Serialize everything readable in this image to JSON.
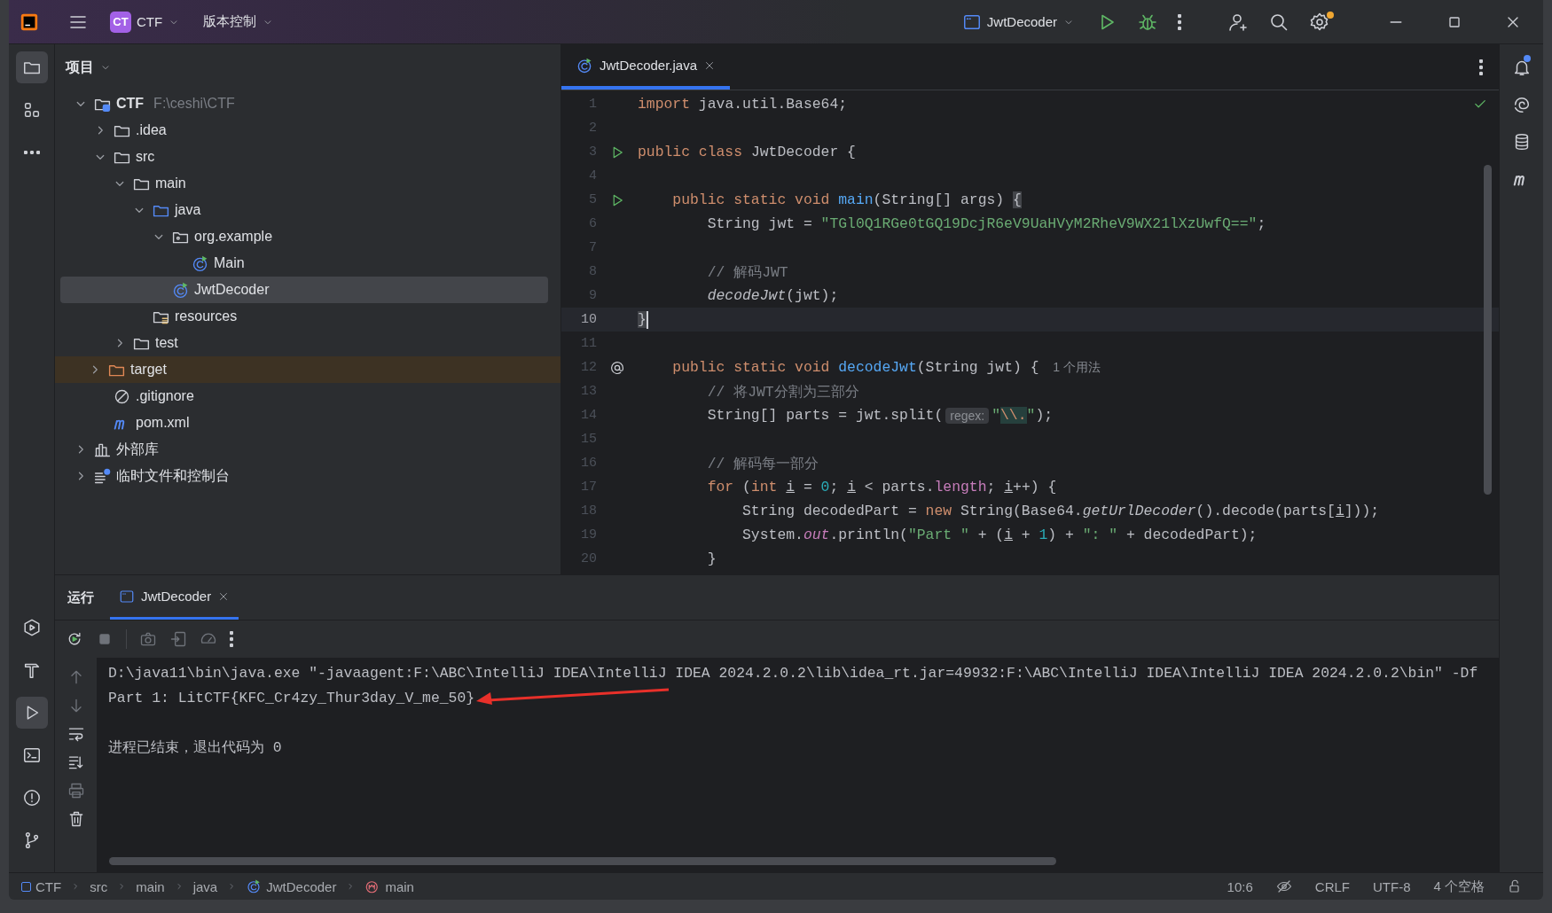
{
  "title_bar": {
    "project_badge": "CT",
    "project": "CTF",
    "vcs": "版本控制",
    "run_config": "JwtDecoder",
    "settings_badge": true
  },
  "tool_strip": {
    "top": [
      {
        "selected": true
      },
      {
        "selected": false
      },
      {
        "selected": false
      }
    ],
    "bottom": [
      {
        "selected": false
      },
      {
        "selected": false
      },
      {
        "selected": true
      },
      {
        "selected": false
      },
      {
        "selected": false
      },
      {
        "selected": false
      }
    ]
  },
  "project_panel": {
    "title": "项目",
    "tree": [
      {
        "label": "CTF",
        "hint": "F:\\ceshi\\CTF",
        "kind": "module",
        "expanded": true,
        "selected": false,
        "children": [
          {
            "label": ".idea",
            "kind": "folder",
            "expanded": false,
            "selected": false
          },
          {
            "label": "src",
            "kind": "folder",
            "expanded": true,
            "selected": false,
            "children": [
              {
                "label": "main",
                "kind": "folder",
                "expanded": true,
                "selected": false,
                "children": [
                  {
                    "label": "java",
                    "kind": "sources",
                    "expanded": true,
                    "selected": false,
                    "children": [
                      {
                        "label": "org.example",
                        "kind": "package",
                        "expanded": true,
                        "selected": false,
                        "children": [
                          {
                            "label": "Main",
                            "kind": "class",
                            "selected": false
                          }
                        ]
                      },
                      {
                        "label": "JwtDecoder",
                        "kind": "class",
                        "selected": true
                      }
                    ]
                  },
                  {
                    "label": "resources",
                    "kind": "resources",
                    "selected": false
                  }
                ]
              },
              {
                "label": "test",
                "kind": "folder",
                "expanded": false,
                "selected": false
              }
            ]
          },
          {
            "label": "target",
            "kind": "excluded",
            "expanded": false,
            "selected": false
          },
          {
            "label": ".gitignore",
            "kind": "ignore",
            "selected": false
          },
          {
            "label": "pom.xml",
            "kind": "maven",
            "selected": false
          }
        ]
      },
      {
        "label": "外部库",
        "kind": "library",
        "expanded": false,
        "selected": false
      },
      {
        "label": "临时文件和控制台",
        "kind": "scratch",
        "expanded": false,
        "selected": false
      }
    ]
  },
  "editor": {
    "tabs": [
      {
        "label": "JwtDecoder.java",
        "selected": true
      }
    ],
    "lines": [
      {
        "n": "1",
        "kind": "plain",
        "current": false,
        "tokens": [
          {
            "kind": "keyword",
            "text": "import"
          },
          {
            "kind": "plain",
            "text": " java.util.Base64;"
          }
        ]
      },
      {
        "n": "2",
        "kind": "plain",
        "current": false
      },
      {
        "n": "3",
        "kind": "run",
        "current": false,
        "tokens": [
          {
            "kind": "keyword",
            "text": "public class "
          },
          {
            "kind": "plain",
            "text": "JwtDecoder {"
          }
        ]
      },
      {
        "n": "4",
        "kind": "plain",
        "current": false
      },
      {
        "n": "5",
        "kind": "run",
        "current": false,
        "tokens": [
          {
            "kind": "keyword",
            "text": "    public static void "
          },
          {
            "kind": "declaration",
            "text": "main"
          },
          {
            "kind": "plain",
            "text": "(String[] args) "
          },
          {
            "kind": "brace",
            "text": "{"
          }
        ]
      },
      {
        "n": "6",
        "kind": "plain",
        "current": false,
        "tokens": [
          {
            "kind": "plain",
            "text": "        String jwt = "
          },
          {
            "kind": "string",
            "text": "\"TGl0Q1RGe0tGQ19DcjR6eV9UaHVyM2RheV9WX21lXzUwfQ==\""
          },
          {
            "kind": "plain",
            "text": ";"
          }
        ]
      },
      {
        "n": "7",
        "kind": "plain",
        "current": false
      },
      {
        "n": "8",
        "kind": "plain",
        "current": false,
        "tokens": [
          {
            "kind": "comment",
            "text": "        // 解码JWT"
          }
        ]
      },
      {
        "n": "9",
        "kind": "plain",
        "current": false,
        "tokens": [
          {
            "kind": "static",
            "text": "        decodeJwt"
          },
          {
            "kind": "plain",
            "text": "(jwt);"
          }
        ]
      },
      {
        "n": "10",
        "kind": "plain",
        "current": true,
        "tokens": [
          {
            "kind": "brace",
            "text": "    }"
          }
        ]
      },
      {
        "n": "11",
        "kind": "plain",
        "current": false
      },
      {
        "n": "12",
        "kind": "override",
        "current": false,
        "tokens": [
          {
            "kind": "keyword",
            "text": "    public static void "
          },
          {
            "kind": "declaration",
            "text": "decodeJwt"
          },
          {
            "kind": "plain",
            "text": "(String jwt) { "
          },
          {
            "kind": "usage",
            "text": "1 个用法"
          }
        ]
      },
      {
        "n": "13",
        "kind": "plain",
        "current": false,
        "tokens": [
          {
            "kind": "comment",
            "text": "        // 将JWT分割为三部分"
          }
        ]
      },
      {
        "n": "14",
        "kind": "plain",
        "current": false,
        "tokens": [
          {
            "kind": "plain",
            "text": "        String[] parts = jwt.split("
          },
          {
            "kind": "hint",
            "text": "regex:"
          },
          {
            "kind": "string",
            "text": "\""
          },
          {
            "kind": "escape",
            "text": "\\\\."
          },
          {
            "kind": "string",
            "text": "\""
          },
          {
            "kind": "plain",
            "text": ");"
          }
        ]
      },
      {
        "n": "15",
        "kind": "plain",
        "current": false
      },
      {
        "n": "16",
        "kind": "plain",
        "current": false,
        "tokens": [
          {
            "kind": "comment",
            "text": "        // 解码每一部分"
          }
        ]
      },
      {
        "n": "17",
        "kind": "plain",
        "current": false,
        "tokens": [
          {
            "kind": "keyword",
            "text": "        for "
          },
          {
            "kind": "plain",
            "text": "("
          },
          {
            "kind": "keyword",
            "text": "int "
          },
          {
            "kind": "variable",
            "text": "i"
          },
          {
            "kind": "plain",
            "text": " = "
          },
          {
            "kind": "number",
            "text": "0"
          },
          {
            "kind": "plain",
            "text": "; "
          },
          {
            "kind": "variable",
            "text": "i"
          },
          {
            "kind": "plain",
            "text": " < parts."
          },
          {
            "kind": "field",
            "text": "length"
          },
          {
            "kind": "plain",
            "text": "; "
          },
          {
            "kind": "variable",
            "text": "i"
          },
          {
            "kind": "plain",
            "text": "++) {"
          }
        ]
      },
      {
        "n": "18",
        "kind": "plain",
        "current": false,
        "tokens": [
          {
            "kind": "plain",
            "text": "            String decodedPart = "
          },
          {
            "kind": "keyword",
            "text": "new "
          },
          {
            "kind": "plain",
            "text": "String(Base64."
          },
          {
            "kind": "static",
            "text": "getUrlDecoder"
          },
          {
            "kind": "plain",
            "text": "().decode(parts["
          },
          {
            "kind": "variable",
            "text": "i"
          },
          {
            "kind": "plain",
            "text": "]));"
          }
        ]
      },
      {
        "n": "19",
        "kind": "plain",
        "current": false,
        "tokens": [
          {
            "kind": "plain",
            "text": "            System."
          },
          {
            "kind": "staticfield",
            "text": "out"
          },
          {
            "kind": "plain",
            "text": ".println("
          },
          {
            "kind": "string",
            "text": "\"Part \""
          },
          {
            "kind": "plain",
            "text": " + ("
          },
          {
            "kind": "variable",
            "text": "i"
          },
          {
            "kind": "plain",
            "text": " + "
          },
          {
            "kind": "number",
            "text": "1"
          },
          {
            "kind": "plain",
            "text": ") + "
          },
          {
            "kind": "string",
            "text": "\": \""
          },
          {
            "kind": "plain",
            "text": " + decodedPart);"
          }
        ]
      },
      {
        "n": "20",
        "kind": "plain",
        "current": false,
        "tokens": [
          {
            "kind": "plain",
            "text": "        }"
          }
        ]
      }
    ]
  },
  "right_strip": [
    {
      "badge": true
    },
    {
      "badge": false
    },
    {
      "badge": false
    },
    {
      "badge": false
    }
  ],
  "run_panel": {
    "title": "运行",
    "tabs": [
      {
        "label": "JwtDecoder",
        "selected": true
      }
    ],
    "output": [
      {
        "kind": "command",
        "text": "D:\\java11\\bin\\java.exe \"-javaagent:F:\\ABC\\IntelliJ IDEA\\IntelliJ IDEA 2024.2.0.2\\lib\\idea_rt.jar=49932:F:\\ABC\\IntelliJ IDEA\\IntelliJ IDEA 2024.2.0.2\\bin\" -Df"
      },
      {
        "kind": "output",
        "text": "Part 1: LitCTF{KFC_Cr4zy_Thur3day_V_me_50}"
      },
      {
        "kind": "exit",
        "text": "进程已结束，退出代码为 0"
      }
    ],
    "annotations": [
      {
        "kind": "arrow"
      }
    ]
  },
  "status_bar": {
    "breadcrumbs": [
      {
        "label": "CTF",
        "kind": "module"
      },
      {
        "label": "src",
        "kind": "plain"
      },
      {
        "label": "main",
        "kind": "plain"
      },
      {
        "label": "java",
        "kind": "plain"
      },
      {
        "label": "JwtDecoder",
        "kind": "class"
      },
      {
        "label": "main",
        "kind": "method"
      }
    ],
    "position": "10:6",
    "line_ending": "CRLF",
    "encoding": "UTF-8",
    "indent": "4 个空格"
  }
}
